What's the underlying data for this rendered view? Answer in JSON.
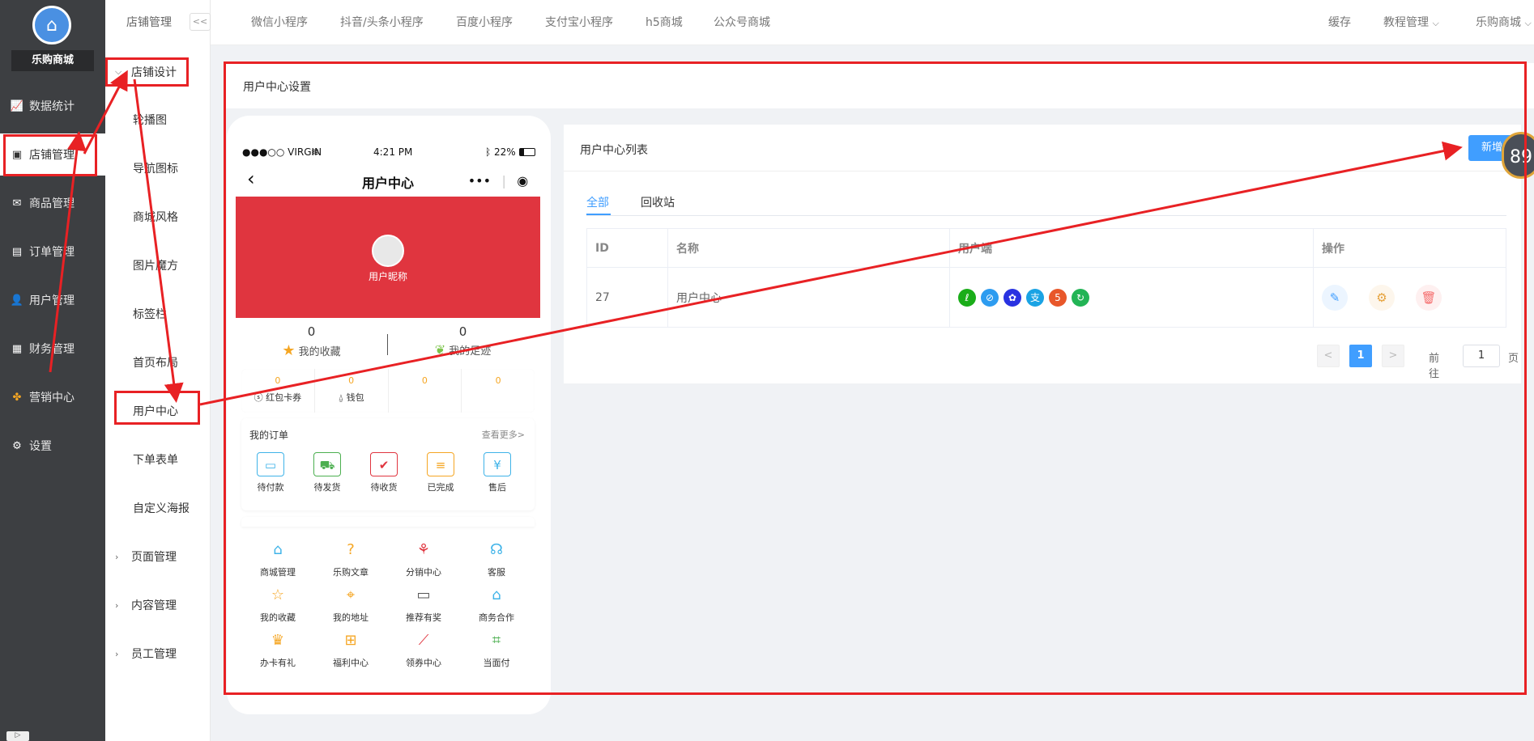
{
  "app": {
    "logo_text": "乐购商城"
  },
  "sidebar": {
    "items": [
      {
        "label": "数据统计",
        "icon": "chart-icon"
      },
      {
        "label": "店铺管理",
        "icon": "store-icon"
      },
      {
        "label": "商品管理",
        "icon": "mail-icon"
      },
      {
        "label": "订单管理",
        "icon": "order-icon"
      },
      {
        "label": "用户管理",
        "icon": "user-icon"
      },
      {
        "label": "财务管理",
        "icon": "finance-icon"
      },
      {
        "label": "营销中心",
        "icon": "marketing-icon"
      },
      {
        "label": "设置",
        "icon": "gear-icon"
      }
    ],
    "collapse": "▷"
  },
  "subnav": {
    "title": "店铺管理",
    "collapse": "<<",
    "group_shop_design": "店铺设计",
    "items": [
      "轮播图",
      "导航图标",
      "商城风格",
      "图片魔方",
      "标签栏",
      "首页布局",
      "用户中心",
      "下单表单",
      "自定义海报"
    ],
    "groups": [
      "页面管理",
      "内容管理",
      "员工管理"
    ]
  },
  "topbar": {
    "tabs": [
      "微信小程序",
      "抖音/头条小程序",
      "百度小程序",
      "支付宝小程序",
      "h5商城",
      "公众号商城"
    ],
    "cache": "缓存",
    "tutorial": "教程管理",
    "store": "乐购商城"
  },
  "page": {
    "title": "用户中心设置"
  },
  "phone": {
    "carrier": "●●●○○ VIRGIN",
    "time": "4:21 PM",
    "battery": "22%",
    "nav_title": "用户中心",
    "nickname": "用户昵称",
    "favorites_count": "0",
    "favorites_label": "我的收藏",
    "footprint_count": "0",
    "footprint_label": "我的足迹",
    "wallet": [
      {
        "value": "0",
        "label": "红包卡券"
      },
      {
        "value": "0",
        "label": "钱包"
      },
      {
        "value": "0",
        "label": ""
      },
      {
        "value": "0",
        "label": ""
      }
    ],
    "orders_title": "我的订单",
    "orders_more": "查看更多>",
    "orders": [
      "待付款",
      "待发货",
      "待收货",
      "已完成",
      "售后"
    ],
    "tools": [
      "商城管理",
      "乐购文章",
      "分销中心",
      "客服",
      "我的收藏",
      "我的地址",
      "推荐有奖",
      "商务合作",
      "办卡有礼",
      "福利中心",
      "领券中心",
      "当面付"
    ]
  },
  "list": {
    "title": "用户中心列表",
    "add_button": "新增",
    "badge": "89",
    "tab_all": "全部",
    "tab_recycle": "回收站",
    "columns": [
      "ID",
      "名称",
      "用户端",
      "操作"
    ],
    "rows": [
      {
        "id": "27",
        "name": "用户中心"
      }
    ],
    "pager_prev": "<",
    "pager_current": "1",
    "pager_next": ">",
    "goto_label": "前往",
    "goto_value": "1",
    "goto_unit": "页"
  },
  "colors": {
    "annotation": "#e82124",
    "accent": "#409eff",
    "banner": "#e0353f",
    "sidebar": "#3d3f42"
  }
}
